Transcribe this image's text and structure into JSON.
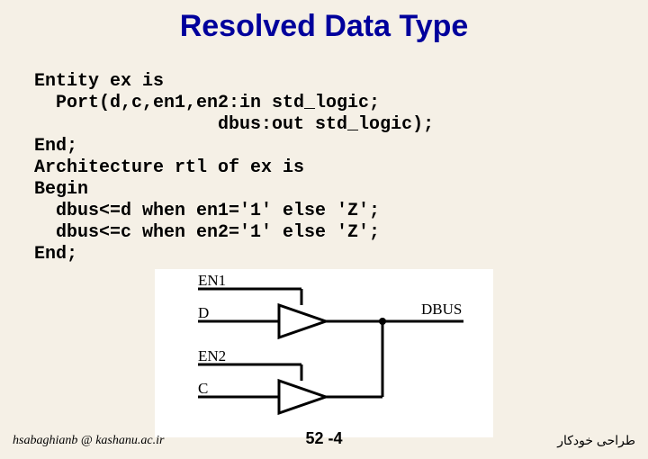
{
  "title": "Resolved Data Type",
  "code": {
    "l1": "Entity ex is",
    "l2": "  Port(d,c,en1,en2:in std_logic;",
    "l3": "                 dbus:out std_logic);",
    "l4": "End;",
    "l5": "Architecture rtl of ex is",
    "l6": "Begin",
    "l7": "  dbus<=d when en1='1' else 'Z';",
    "l8": "  dbus<=c when en2='1' else 'Z';",
    "l9": "End;"
  },
  "diagram": {
    "en1": "EN1",
    "d": "D",
    "en2": "EN2",
    "c": "C",
    "dbus": "DBUS"
  },
  "footer": {
    "left": "hsabaghianb @ kashanu.ac.ir",
    "center": "52 -4",
    "right": "طراحی خودکار"
  }
}
